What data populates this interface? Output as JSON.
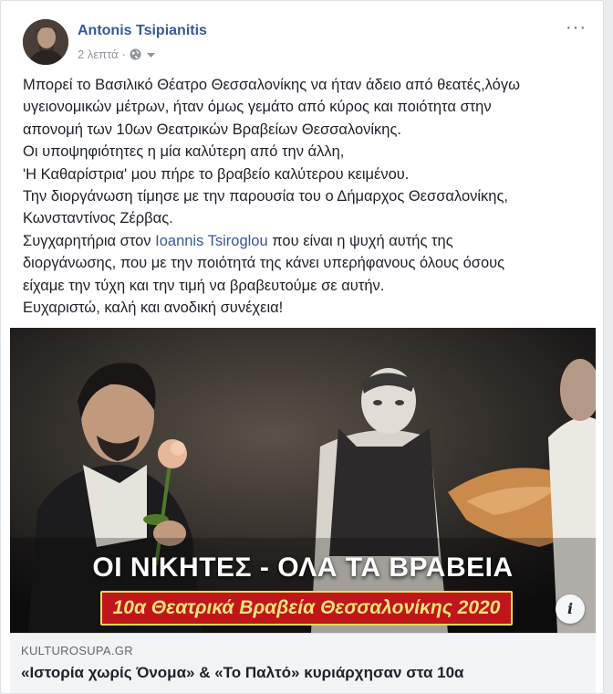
{
  "post": {
    "author": "Antonis Tsipianitis",
    "time": "2 λεπτά",
    "separator": "·",
    "more_icon": "···",
    "text_lines": [
      "Μπορεί το Βασιλικό Θέατρο Θεσσαλονίκης να ήταν άδειο από θεατές,λόγω",
      "υγειονομικών μέτρων, ήταν όμως γεμάτο από κύρος και ποιότητα στην",
      "απονομή των 10ων Θεατρικών Βραβείων Θεσσαλονίκης.",
      "Οι υποψηφιότητες η μία καλύτερη από την άλλη,",
      "'Η Καθαρίστρια' μου πήρε το βραβείο καλύτερου κειμένου.",
      "Την διοργάνωση τίμησε με την παρουσία του ο Δήμαρχος Θεσσαλονίκης,",
      "Κωνσταντίνος Ζέρβας."
    ],
    "mention_line": {
      "before": "Συγχαρητήρια στον ",
      "mention": "Ioannis Tsiroglou",
      "after": " που είναι η ψυχή αυτής της"
    },
    "text_lines_2": [
      "διοργάνωσης, που με την ποιότητά της κάνει υπερήφανους όλους όσους",
      "είχαμε την τύχη και την τιμή να βραβευτούμε σε αυτήν.",
      "Ευχαριστώ, καλή και ανοδική συνέχεια!"
    ]
  },
  "image": {
    "banner_main": "ΟΙ ΝΙΚΗΤΕΣ - ΟΛΑ ΤΑ ΒΡΑΒΕΙΑ",
    "banner_sub": "10α Θεατρικά Βραβεία Θεσσαλονίκης 2020",
    "info_label": "i"
  },
  "link": {
    "domain": "KULTUROSUPA.GR",
    "title": "«Ιστορία χωρίς Όνομα» & «Το Παλτό» κυριάρχησαν στα 10α"
  },
  "colors": {
    "author_link": "#385898",
    "banner_red": "#c0161b",
    "banner_text": "#f9e27a"
  }
}
